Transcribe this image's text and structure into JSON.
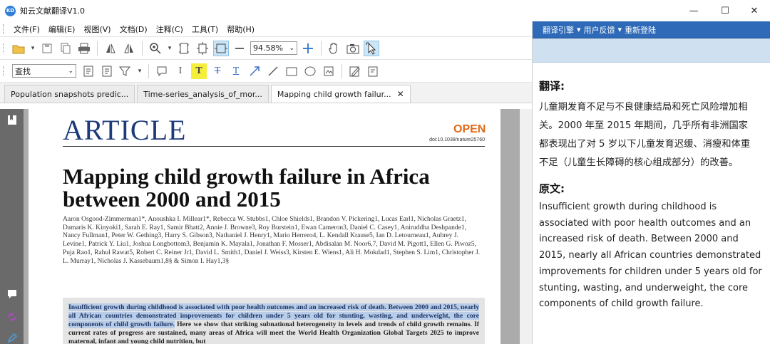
{
  "app": {
    "icon_text": "KD",
    "title": "知云文献翻译V1.0"
  },
  "window_controls": {
    "minimize": "—",
    "maximize": "☐",
    "close": "✕"
  },
  "menu": [
    "文件(F)",
    "编辑(E)",
    "视图(V)",
    "文档(D)",
    "注释(C)",
    "工具(T)",
    "帮助(H)"
  ],
  "toolbar": {
    "zoom_value": "94.58%",
    "search_value": "查找"
  },
  "tabs": [
    {
      "label": "Population snapshots predic...",
      "active": false
    },
    {
      "label": "Time-series_analysis_of_mor...",
      "active": false
    },
    {
      "label": "Mapping child growth failur...",
      "active": true
    }
  ],
  "tab_close": "✕",
  "document": {
    "header": "ARTICLE",
    "open_badge": "OPEN",
    "doi": "doi:10.1038/nature25760",
    "headline": "Mapping child growth failure in Africa between 2000 and 2015",
    "authors": "Aaron Osgood-Zimmerman1*, Anoushka I. Millear1*, Rebecca W. Stubbs1, Chloe Shields1, Brandon V. Pickering1, Lucas Earl1, Nicholas Graetz1, Damaris K. Kinyoki1, Sarah E. Ray1, Samir Bhatt2, Annie J. Browne3, Roy Burstein1, Ewan Cameron3, Daniel C. Casey1, Aniruddha Deshpande1, Nancy Fullman1, Peter W. Gething3, Harry S. Gibson3, Nathaniel J. Henry1, Mario Herrero4, L. Kendall Krause5, Ian D. Letourneau1, Aubrey J. Levine1, Patrick Y. Liu1, Joshua Longbottom3, Benjamin K. Mayala1, Jonathan F. Mosser1, Abdisalan M. Noor6,7, David M. Pigott1, Ellen G. Piwoz5, Puja Rao1, Rahul Rawat5, Robert C. Reiner Jr1, David L. Smith1, Daniel J. Weiss3, Kirsten E. Wiens1, Ali H. Mokdad1, Stephen S. Lim1, Christopher J. L. Murray1, Nicholas J. Kassebaum1,8§ & Simon I. Hay1,3§",
    "abstract_highlight": "Insufficient growth during childhood is associated with poor health outcomes and an increased risk of death. Between 2000 and 2015, nearly all African countries demonstrated improvements for children under 5 years old for stunting, wasting, and underweight, the core components of child growth failure.",
    "abstract_rest": " Here we show that striking subnational heterogeneity in levels and trends of child growth remains. If current rates of progress are sustained, many areas of Africa will meet the World Health Organization Global Targets 2025 to improve maternal, infant and young child nutrition, but"
  },
  "right_panel": {
    "bar_items": [
      "翻译引擎",
      "▾",
      "用户反馈",
      "▾",
      "重新登陆"
    ],
    "translation_heading": "翻译:",
    "translation_lines": [
      "儿童期发育不足与不良健康结局和死亡风险增加相",
      "关。2000 年至 2015 年期间，几乎所有非洲国家",
      "都表现出了对 5 岁以下儿童发育迟缓、消瘦和体重",
      "不足（儿童生长障碍的核心组成部分）的改善。"
    ],
    "original_heading": "原文:",
    "original_lines": [
      "Insufficient growth during childhood is",
      "associated with poor health outcomes and an",
      "increased risk of death. Between 2000 and",
      "2015, nearly all African countries demonstrated",
      "improvements for children under 5 years old for",
      "stunting, wasting, and underweight, the core",
      "components of child growth failure."
    ]
  }
}
